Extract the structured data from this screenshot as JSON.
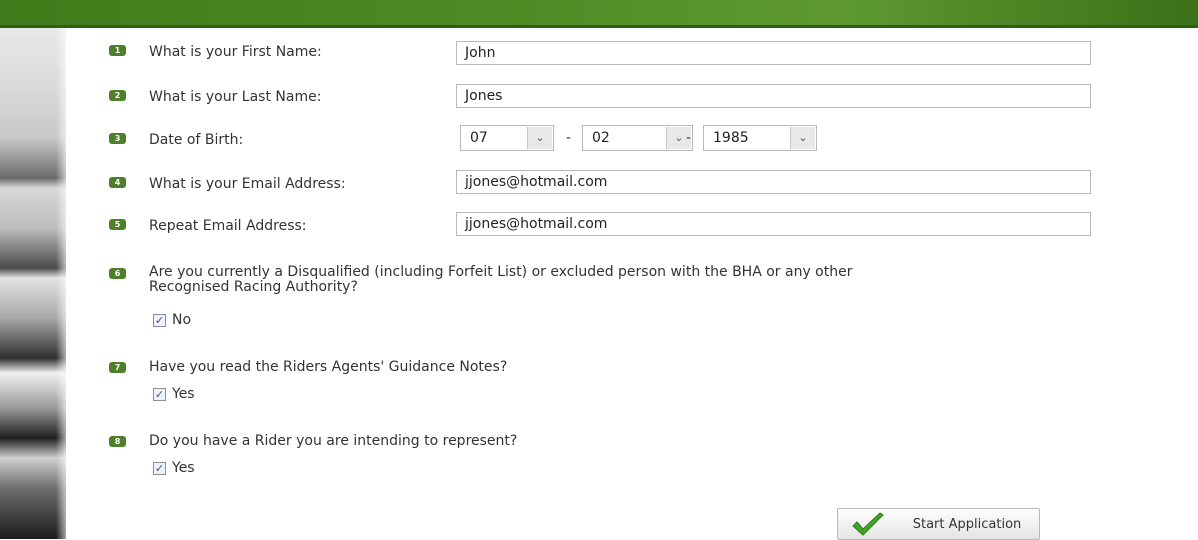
{
  "questions": [
    {
      "num": "1",
      "label": "What is your First Name:"
    },
    {
      "num": "2",
      "label": "What is your Last Name:"
    },
    {
      "num": "3",
      "label": "Date of Birth:"
    },
    {
      "num": "4",
      "label": "What is your Email Address:"
    },
    {
      "num": "5",
      "label": "Repeat Email Address:"
    },
    {
      "num": "6",
      "label_line1": "Are you currently a Disqualified (including Forfeit List) or excluded person with the BHA or any other",
      "label_line2": "Recognised Racing Authority?",
      "answer": "No"
    },
    {
      "num": "7",
      "label": "Have you read the Riders Agents' Guidance Notes?",
      "answer": "Yes"
    },
    {
      "num": "8",
      "label": "Do you have a Rider you are intending to represent?",
      "answer": "Yes"
    }
  ],
  "fields": {
    "first_name": "John",
    "last_name": "Jones",
    "email": "jjones@hotmail.com",
    "email_repeat": "jjones@hotmail.com"
  },
  "dob": {
    "day": "07",
    "month": "02",
    "year": "1985",
    "separator": "-"
  },
  "checkbox_mark": "✓",
  "button": {
    "label": "Start Application",
    "icon": "check-icon"
  },
  "colors": {
    "accent_green": "#4e7f2a",
    "topbar_green": "#4d8a23",
    "checkmark_green": "#3fa623"
  }
}
